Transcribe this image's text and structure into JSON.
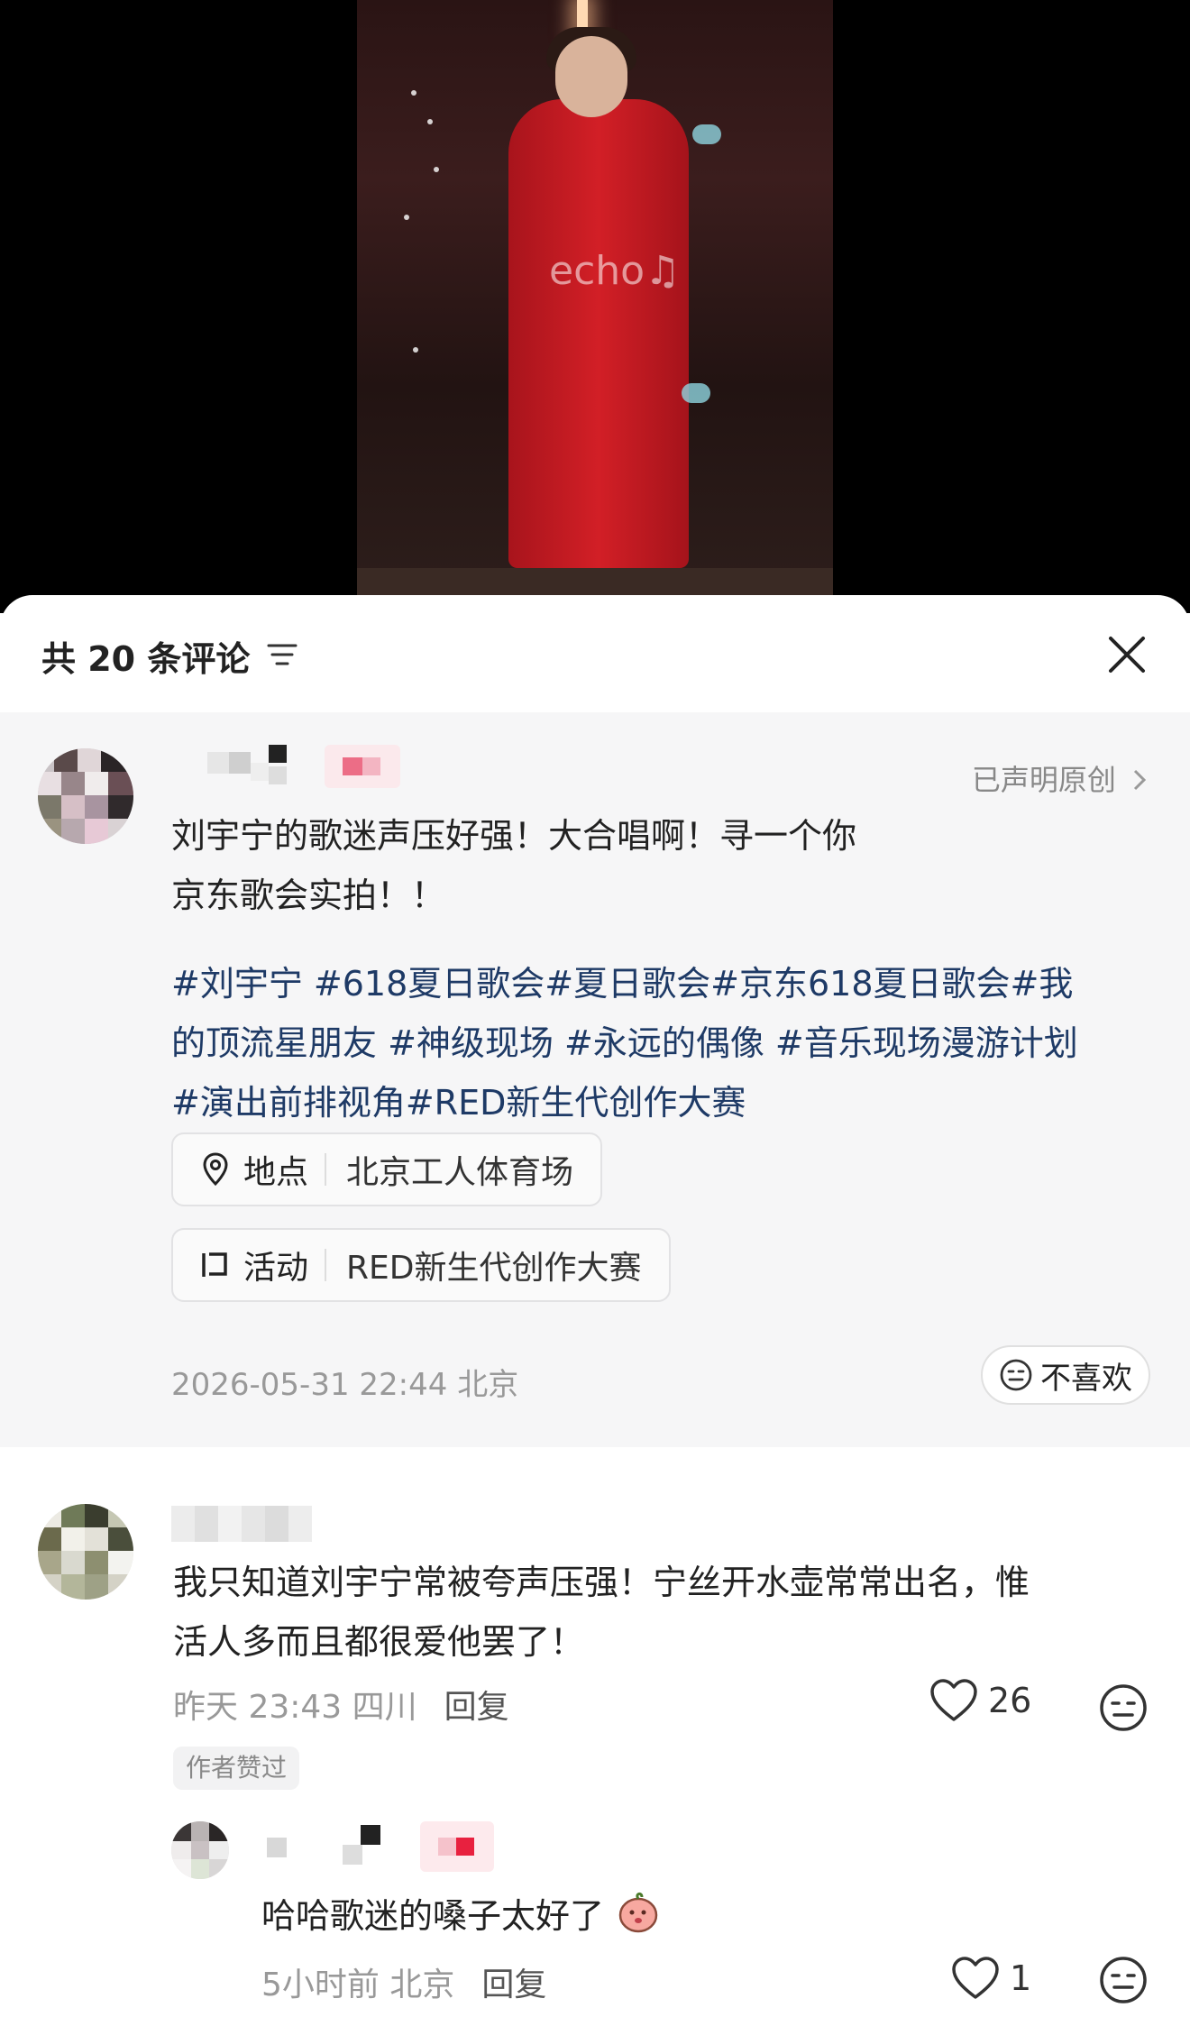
{
  "video": {
    "watermark": "echo♫"
  },
  "header": {
    "comment_count": "共 20 条评论",
    "sort_icon": "filter-lines-icon",
    "close_icon": "close-icon"
  },
  "post": {
    "declared_label": "已声明原创",
    "text_line1": "刘宇宁的歌迷声压好强！大合唱啊！寻一个你",
    "text_line2": "京东歌会实拍！！",
    "hashtag_line1": "#刘宇宁 #618夏日歌会#夏日歌会#京东618夏日歌会#我",
    "hashtag_line2": "的顶流星朋友 #神级现场 #永远的偶像 #音乐现场漫游计划",
    "hashtag_line3": "#演出前排视角#RED新生代创作大赛",
    "location_key": "地点",
    "location_value": "北京工人体育场",
    "activity_key": "活动",
    "activity_value": "RED新生代创作大赛",
    "datetime": "2026-05-31 22:44 北京",
    "dislike_label": "不喜欢"
  },
  "comments": [
    {
      "text_line1": "我只知道刘宇宁常被夸声压强！宁丝开水壶常常出名，惟",
      "text_line2": "活人多而且都很爱他罢了！",
      "time_location": "昨天 23:43 四川",
      "reply_label": "回复",
      "likes": "26",
      "badge": "作者赞过"
    },
    {
      "text": "哈哈歌迷的嗓子太好了",
      "emoji": "peach-emoji",
      "time_location": "5小时前 北京",
      "reply_label": "回复",
      "likes": "1"
    }
  ],
  "colors": {
    "hashtag": "#1e3a66",
    "gown": "#d21f26",
    "muted": "#999999"
  }
}
